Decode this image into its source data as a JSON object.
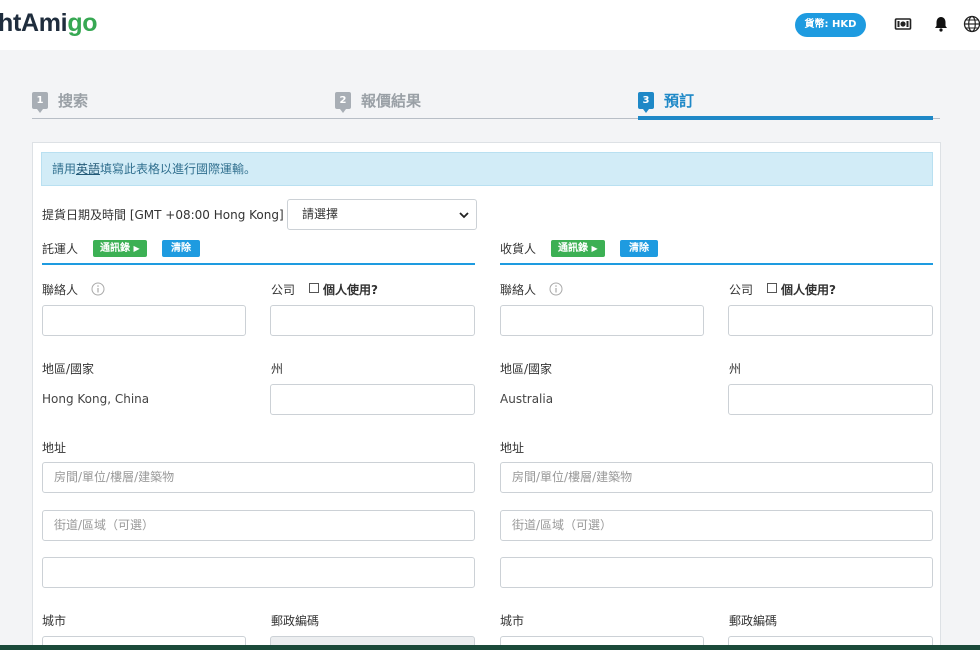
{
  "header": {
    "logo_part1": "htAmi",
    "logo_part2": "go",
    "currency_label": "貨幣: HKD",
    "icons": [
      "money-icon",
      "bell-icon",
      "globe-icon"
    ]
  },
  "steps": [
    {
      "num": "1",
      "label": "搜索",
      "active": false
    },
    {
      "num": "2",
      "label": "報價結果",
      "active": false
    },
    {
      "num": "3",
      "label": "預訂",
      "active": true
    }
  ],
  "notice": {
    "prefix": "請用",
    "link": "英語",
    "suffix": "填寫此表格以進行國際運輸。"
  },
  "pickup": {
    "label": "提貨日期及時間 [GMT +08:00 Hong Kong]",
    "select_value": "請選擇"
  },
  "shipper": {
    "title": "託運人",
    "address_book_label": "通訊錄",
    "clear_label": "清除",
    "contact_label": "聯絡人",
    "company_label": "公司",
    "personal_use_label": "個人使用?",
    "region_label": "地區/國家",
    "region_value": "Hong Kong, China",
    "state_label": "州",
    "address_label": "地址",
    "address1_placeholder": "房間/單位/樓層/建築物",
    "address2_placeholder": "街道/區域（可選）",
    "city_label": "城市",
    "postal_label": "郵政編碼"
  },
  "consignee": {
    "title": "收貨人",
    "address_book_label": "通訊錄",
    "clear_label": "清除",
    "contact_label": "聯絡人",
    "company_label": "公司",
    "personal_use_label": "個人使用?",
    "region_label": "地區/國家",
    "region_value": "Australia",
    "state_label": "州",
    "address_label": "地址",
    "address1_placeholder": "房間/單位/樓層/建築物",
    "address2_placeholder": "街道/區域（可選）",
    "city_label": "城市",
    "postal_label": "郵政編碼"
  },
  "colors": {
    "accent": "#1e9be0",
    "step_active": "#1e88c7",
    "green": "#3cb054",
    "notice_bg": "#d2ecf7"
  }
}
